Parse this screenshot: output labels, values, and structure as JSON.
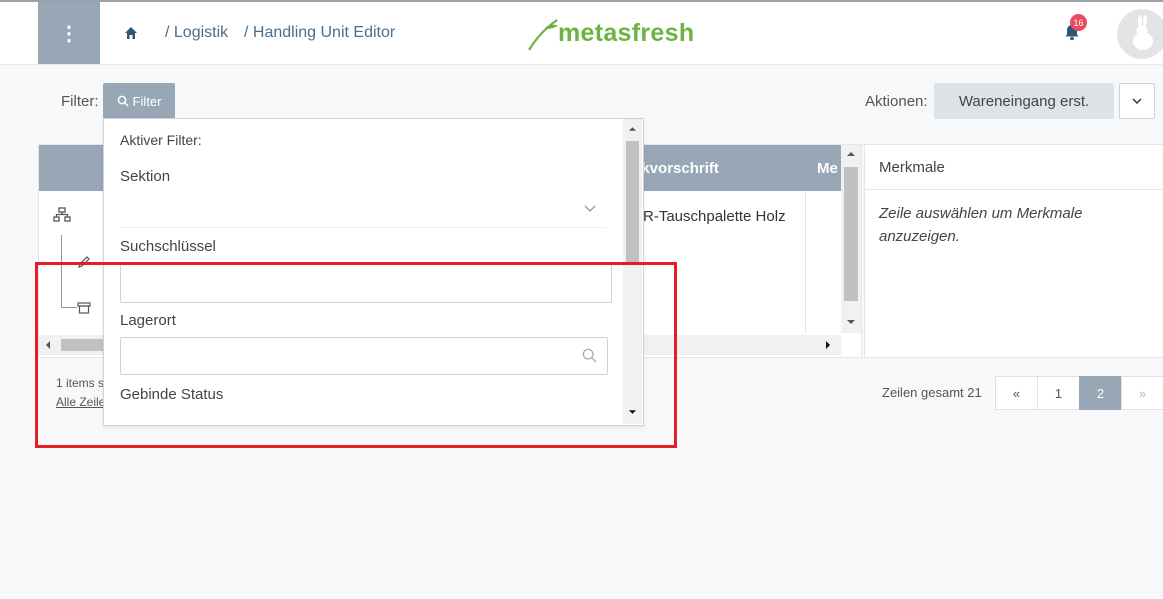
{
  "header": {
    "breadcrumb": [
      "/ Logistik",
      "/ Handling Unit Editor"
    ],
    "logo_text": "metasfresh",
    "notification_count": "16"
  },
  "toolbar": {
    "filter_label": "Filter:",
    "filter_button": "Filter",
    "actions_label": "Aktionen:",
    "action_button": "Wareneingang erst."
  },
  "table": {
    "columns": [
      "ckvorschrift",
      "Me"
    ],
    "cell_packing": "R-Tauschpalette Holz"
  },
  "merkmale": {
    "title": "Merkmale",
    "empty_text": "Zeile auswählen um Merkmale anzuzeigen."
  },
  "footer": {
    "items_text": "1 items s",
    "select_all": "Alle Zeile",
    "total_rows": "Zeilen gesamt 21",
    "pages": [
      "«",
      "1",
      "2",
      "»"
    ],
    "active_page": "2"
  },
  "filter_dropdown": {
    "active_filter_label": "Aktiver Filter:",
    "fields": [
      "Sektion",
      "Suchschlüssel",
      "Lagerort",
      "Gebinde Status"
    ]
  },
  "colors": {
    "accent": "#97a7b5",
    "brand_green": "#6cb33f",
    "badge": "#e94b5d",
    "highlight_box": "#e31e26"
  }
}
